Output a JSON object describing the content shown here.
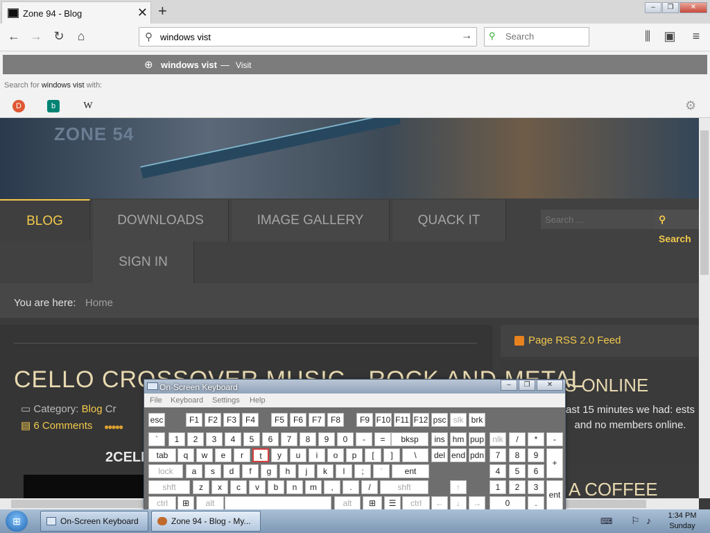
{
  "browser": {
    "tab_title": "Zone 94 - Blog",
    "window_buttons": [
      "–",
      "❐",
      "✕"
    ],
    "url_value": "windows vist",
    "search_placeholder": "Search"
  },
  "dropdown": {
    "suggestion_text": "windows vist",
    "suggestion_sep": "—",
    "suggestion_action": "Visit",
    "search_for_prefix": "Search for",
    "search_for_term": "windows vist",
    "search_for_suffix": "with:",
    "engines": [
      {
        "icon": "duckduckgo-icon",
        "glyph": "D",
        "color": "#de5833"
      },
      {
        "icon": "bing-icon",
        "glyph": "b",
        "color": "#008373"
      },
      {
        "icon": "wikipedia-icon",
        "glyph": "W",
        "color": "#ffffff"
      }
    ]
  },
  "site": {
    "logo": "ZONE 54",
    "menu": [
      "BLOG",
      "DOWNLOADS",
      "IMAGE GALLERY",
      "QUACK IT",
      "SIGN IN"
    ],
    "search_placeholder": "Search ...",
    "search_button": "Search",
    "breadcrumb_label": "You are here:",
    "breadcrumb_home": "Home",
    "article_title": "CELLO CROSSOVER MUSIC - ROCK AND METAL",
    "category_label": "Category:",
    "category_value": "Blog",
    "category_extra": "Cr",
    "comments": "6 Comments",
    "rating_stars": "●●●●●",
    "video_title": "2CELL",
    "rss": "Page RSS 2.0 Feed",
    "online_title": "S ONLINE",
    "online_text": "ast 15 minutes we had: ests and no members online.",
    "coffee_title": "A COFFEE"
  },
  "osk": {
    "title": "On-Screen Keyboard",
    "menu": [
      "File",
      "Keyboard",
      "Settings",
      "Help"
    ],
    "rows": {
      "r1": [
        "esc",
        "F1",
        "F2",
        "F3",
        "F4",
        "F5",
        "F6",
        "F7",
        "F8",
        "F9",
        "F10",
        "F11",
        "F12",
        "psc",
        "slk",
        "brk"
      ],
      "r2": [
        "`",
        "1",
        "2",
        "3",
        "4",
        "5",
        "6",
        "7",
        "8",
        "9",
        "0",
        "-",
        "=",
        "bksp",
        "ins",
        "hm",
        "pup",
        "nlk",
        "/",
        "*",
        "-"
      ],
      "r3": [
        "tab",
        "q",
        "w",
        "e",
        "r",
        "t",
        "y",
        "u",
        "i",
        "o",
        "p",
        "[",
        "]",
        "\\",
        "del",
        "end",
        "pdn",
        "7",
        "8",
        "9",
        "+"
      ],
      "r4": [
        "lock",
        "a",
        "s",
        "d",
        "f",
        "g",
        "h",
        "j",
        "k",
        "l",
        ";",
        "'",
        "ent",
        "4",
        "5",
        "6"
      ],
      "r5": [
        "shft",
        "z",
        "x",
        "c",
        "v",
        "b",
        "n",
        "m",
        ",",
        ".",
        "/",
        "shft",
        "↑",
        "1",
        "2",
        "3",
        "ent"
      ],
      "r6": [
        "ctrl",
        "⊞",
        "alt",
        "",
        "alt",
        "⊞",
        "☰",
        "ctrl",
        "←",
        "↓",
        "→",
        "0",
        "."
      ]
    }
  },
  "taskbar": {
    "items": [
      "On-Screen Keyboard",
      "Zone 94 - Blog - My..."
    ],
    "time": "1:34 PM",
    "day": "Sunday"
  }
}
